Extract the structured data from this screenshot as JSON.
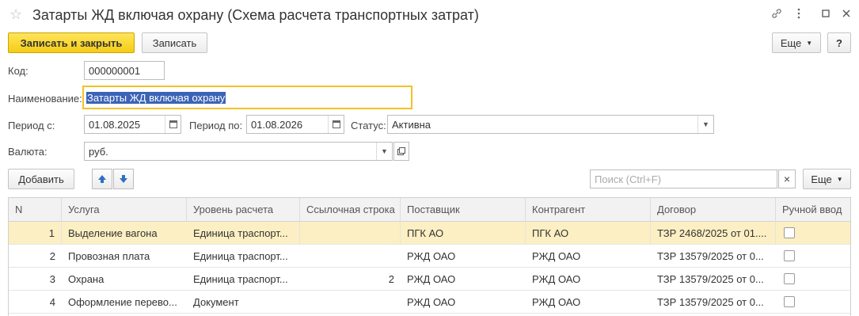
{
  "window": {
    "title": "Затарты ЖД включая охрану (Схема расчета транспортных затрат)"
  },
  "toolbar": {
    "save_close": "Записать и закрыть",
    "save": "Записать",
    "more": "Еще",
    "help": "?"
  },
  "form": {
    "code_label": "Код:",
    "code_value": "000000001",
    "name_label": "Наименование:",
    "name_value": "Затарты ЖД включая охрану",
    "period_from_label": "Период с:",
    "period_from_value": "01.08.2025",
    "period_to_label": "Период по:",
    "period_to_value": "01.08.2026",
    "status_label": "Статус:",
    "status_value": "Активна",
    "currency_label": "Валюта:",
    "currency_value": "руб."
  },
  "table_toolbar": {
    "add": "Добавить",
    "search_placeholder": "Поиск (Ctrl+F)",
    "clear": "×",
    "more": "Еще"
  },
  "table": {
    "columns": [
      "N",
      "Услуга",
      "Уровень расчета",
      "Ссылочная строка",
      "Поставщик",
      "Контрагент",
      "Договор",
      "Ручной ввод"
    ],
    "rows": [
      {
        "n": "1",
        "service": "Выделение вагона",
        "level": "Единица траспорт...",
        "ref": "",
        "supplier": "ПГК АО",
        "counterparty": "ПГК АО",
        "contract": "ТЗР 2468/2025 от 01....",
        "manual": false
      },
      {
        "n": "2",
        "service": "Провозная плата",
        "level": "Единица траспорт...",
        "ref": "",
        "supplier": "РЖД ОАО",
        "counterparty": "РЖД ОАО",
        "contract": "ТЗР 13579/2025 от 0...",
        "manual": false
      },
      {
        "n": "3",
        "service": "Охрана",
        "level": "Единица траспорт...",
        "ref": "2",
        "supplier": "РЖД ОАО",
        "counterparty": "РЖД ОАО",
        "contract": "ТЗР 13579/2025 от 0...",
        "manual": false
      },
      {
        "n": "4",
        "service": "Оформление перево...",
        "level": "Документ",
        "ref": "",
        "supplier": "РЖД ОАО",
        "counterparty": "РЖД ОАО",
        "contract": "ТЗР 13579/2025 от 0...",
        "manual": false
      }
    ]
  },
  "colors": {
    "primary_button": "#f5cc14",
    "selected_row": "#fbefc3",
    "focus_border": "#f2c227",
    "text_selection": "#3b63b6"
  }
}
